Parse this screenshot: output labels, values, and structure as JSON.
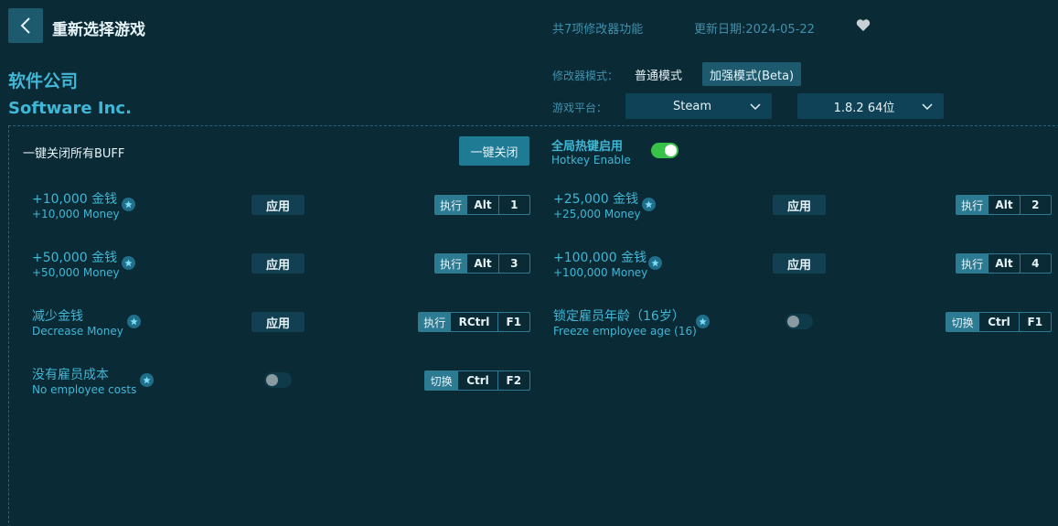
{
  "header": {
    "title": "重新选择游戏",
    "feature_count": "共7项修改器功能",
    "update_date": "更新日期:2024-05-22"
  },
  "game": {
    "name_cn": "软件公司",
    "name_en": "Software Inc."
  },
  "mode": {
    "label": "修改器模式：",
    "normal": "普通模式",
    "enhanced": "加强模式(Beta)"
  },
  "platform": {
    "label": "游戏平台：",
    "selected": "Steam",
    "version": "1.8.2 64位"
  },
  "buff": {
    "label": "一键关闭所有BUFF",
    "close_all": "一键关闭"
  },
  "hotkey": {
    "label_cn": "全局热键启用",
    "label_en": "Hotkey Enable",
    "enabled": true
  },
  "options": [
    {
      "cn": "+10,000 金钱",
      "en": "+10,000 Money",
      "action": "应用",
      "key_action": "执行",
      "keys": [
        "Alt",
        "1"
      ]
    },
    {
      "cn": "+25,000 金钱",
      "en": "+25,000 Money",
      "action": "应用",
      "key_action": "执行",
      "keys": [
        "Alt",
        "2"
      ]
    },
    {
      "cn": "+50,000 金钱",
      "en": "+50,000 Money",
      "action": "应用",
      "key_action": "执行",
      "keys": [
        "Alt",
        "3"
      ]
    },
    {
      "cn": "+100,000 金钱",
      "en": "+100,000 Money",
      "action": "应用",
      "key_action": "执行",
      "keys": [
        "Alt",
        "4"
      ]
    },
    {
      "cn": "减少金钱",
      "en": "Decrease Money",
      "action": "应用",
      "key_action": "执行",
      "keys": [
        "RCtrl",
        "F1"
      ]
    },
    {
      "cn": "锁定雇员年龄（16岁）",
      "en": "Freeze employee age (16)",
      "toggle": false,
      "key_action": "切换",
      "keys": [
        "Ctrl",
        "F1"
      ]
    },
    {
      "cn": "没有雇员成本",
      "en": "No employee costs",
      "toggle": false,
      "key_action": "切换",
      "keys": [
        "Ctrl",
        "F2"
      ]
    }
  ],
  "colors": {
    "background": "#0a2a36",
    "accent": "#3fb7d6",
    "toggle_on": "#39c24a"
  }
}
